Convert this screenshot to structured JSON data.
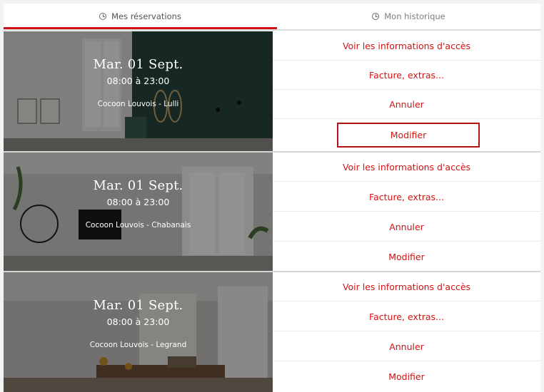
{
  "tabs": [
    {
      "label": "Mes réservations",
      "active": true
    },
    {
      "label": "Mon historique",
      "active": false
    }
  ],
  "accent_color": "#d31313",
  "reservations": [
    {
      "date": "Mar. 01 Sept.",
      "time": "08:00 à 23:00",
      "place": "Cocoon Louvois - Lulli",
      "actions": [
        "Voir les informations d'accès",
        "Facture, extras...",
        "Annuler",
        "Modifier"
      ]
    },
    {
      "date": "Mar. 01 Sept.",
      "time": "08:00 à 23:00",
      "place": "Cocoon Louvois - Chabanais",
      "actions": [
        "Voir les informations d'accès",
        "Facture, extras...",
        "Annuler",
        "Modifier"
      ]
    },
    {
      "date": "Mar. 01 Sept.",
      "time": "08:00 à 23:00",
      "place": "Cocoon Louvois - Legrand",
      "actions": [
        "Voir les informations d'accès",
        "Facture, extras...",
        "Annuler",
        "Modifier"
      ]
    }
  ]
}
